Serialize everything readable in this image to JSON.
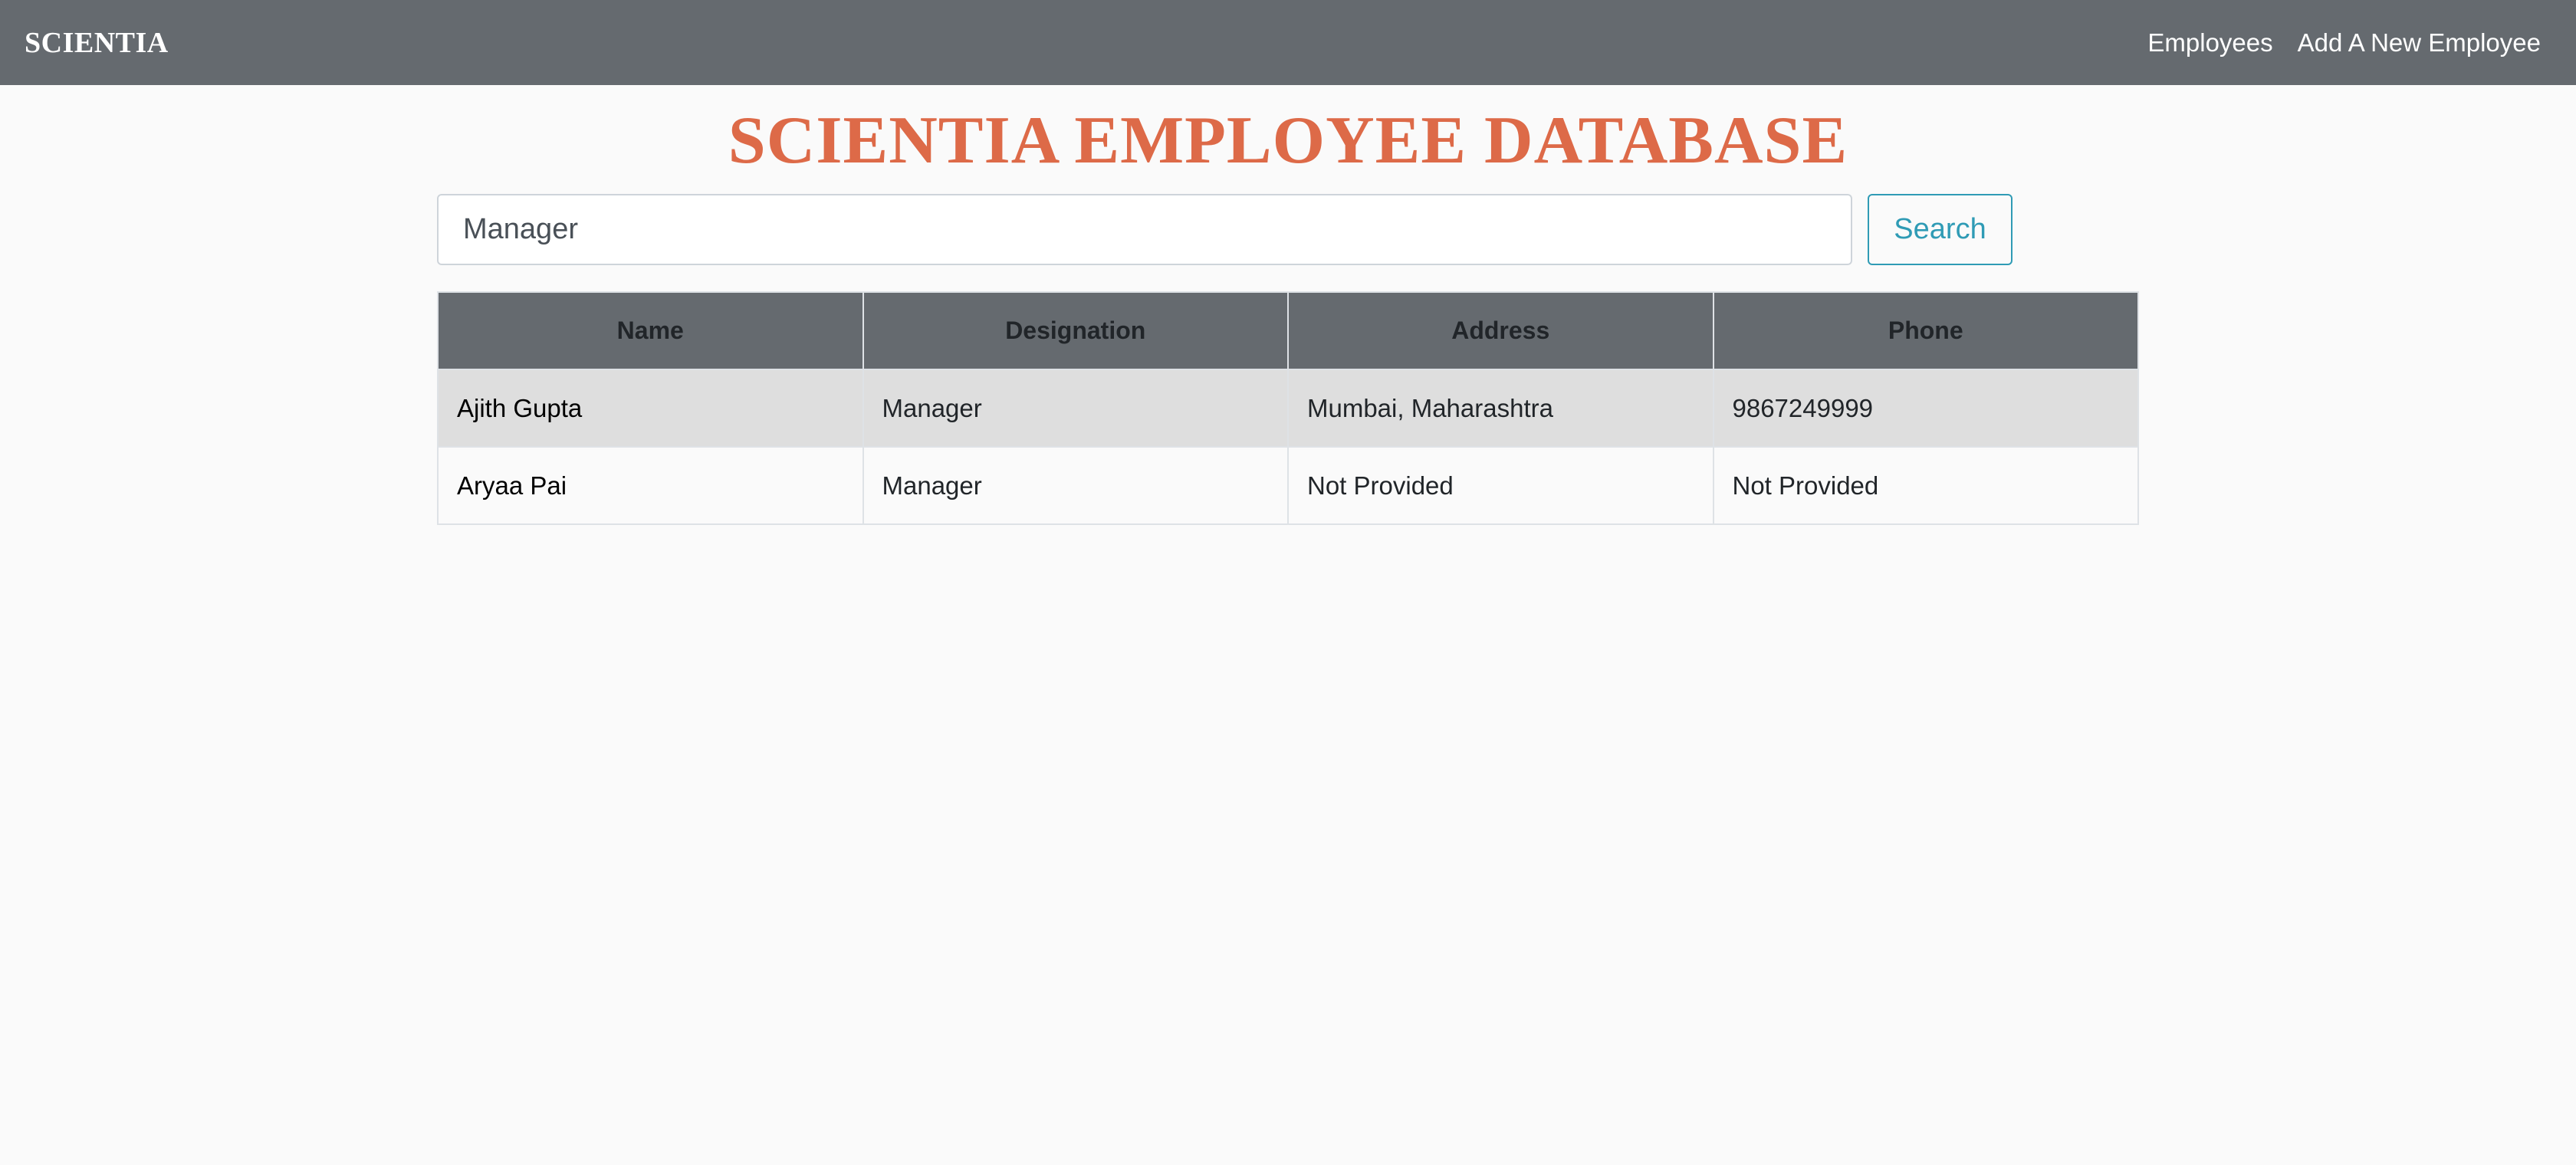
{
  "navbar": {
    "brand": "SCIENTIA",
    "links": [
      "Employees",
      "Add A New Employee"
    ]
  },
  "page_title": "SCIENTIA EMPLOYEE DATABASE",
  "search": {
    "value": "Manager",
    "button_label": "Search"
  },
  "table": {
    "headers": [
      "Name",
      "Designation",
      "Address",
      "Phone"
    ],
    "rows": [
      [
        "Ajith Gupta",
        "Manager",
        "Mumbai, Maharashtra",
        "9867249999"
      ],
      [
        "Aryaa Pai",
        "Manager",
        "Not Provided",
        "Not Provided"
      ]
    ]
  },
  "colors": {
    "navbar": "#656a6f",
    "title": "#dd6a48",
    "search_accent": "#2f9bb5",
    "row_stripe": "#dedede",
    "background": "#fafafa"
  }
}
